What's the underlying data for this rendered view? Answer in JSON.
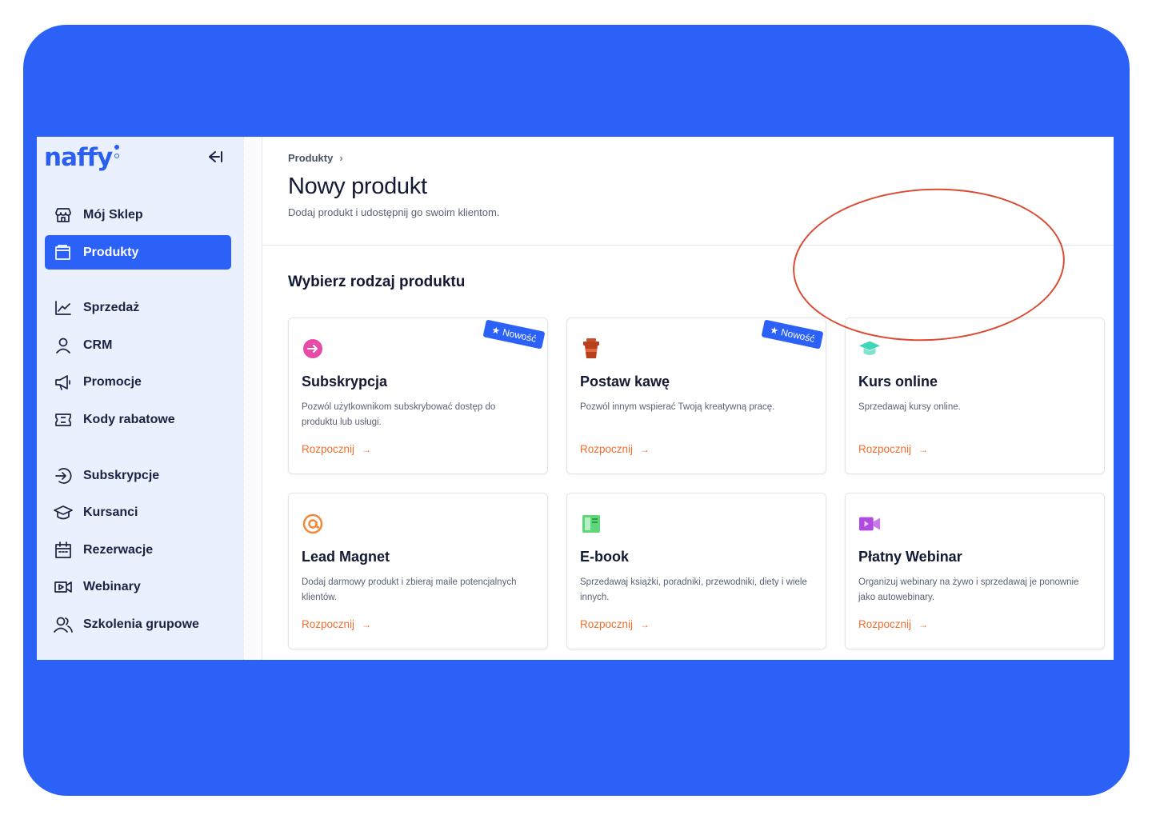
{
  "brand": {
    "logo_text": "naffy"
  },
  "sidebar": {
    "items": [
      {
        "label": "Mój Sklep",
        "icon": "store-icon"
      },
      {
        "label": "Produkty",
        "icon": "folder-icon",
        "active": true
      },
      {
        "label": "Sprzedaż",
        "icon": "chart-line-icon"
      },
      {
        "label": "CRM",
        "icon": "user-icon"
      },
      {
        "label": "Promocje",
        "icon": "megaphone-icon"
      },
      {
        "label": "Kody rabatowe",
        "icon": "ticket-icon"
      },
      {
        "label": "Subskrypcje",
        "icon": "subscription-arrow-icon"
      },
      {
        "label": "Kursanci",
        "icon": "graduation-cap-icon"
      },
      {
        "label": "Rezerwacje",
        "icon": "calendar-icon"
      },
      {
        "label": "Webinary",
        "icon": "video-icon"
      },
      {
        "label": "Szkolenia grupowe",
        "icon": "users-icon"
      }
    ]
  },
  "breadcrumb": {
    "root": "Produkty",
    "separator": "›"
  },
  "header": {
    "title": "Nowy produkt",
    "subtitle": "Dodaj produkt i udostępnij go swoim klientom."
  },
  "section_title": "Wybierz rodzaj produktu",
  "cards": [
    {
      "title": "Subskrypcja",
      "desc": "Pozwól użytkownikom subskrybować dostęp do produktu lub usługi.",
      "link": "Rozpocznij",
      "badge": "★ Nowość",
      "icon": "subscription-icon",
      "color": "#e84aa8"
    },
    {
      "title": "Postaw kawę",
      "desc": "Pozwól innym wspierać Twoją kreatywną pracę.",
      "link": "Rozpocznij",
      "badge": "★ Nowość",
      "icon": "coffee-cup-icon",
      "color": "#b8401f"
    },
    {
      "title": "Kurs online",
      "desc": "Sprzedawaj kursy online.",
      "link": "Rozpocznij",
      "icon": "graduation-cap-icon",
      "color": "#3fd7b8"
    },
    {
      "title": "Lead Magnet",
      "desc": "Dodaj darmowy produkt i zbieraj maile potencjalnych klientów.",
      "link": "Rozpocznij",
      "icon": "at-sign-icon",
      "color": "#f08a3c"
    },
    {
      "title": "E-book",
      "desc": "Sprzedawaj książki, poradniki, przewodniki, diety i wiele innych.",
      "link": "Rozpocznij",
      "icon": "book-icon",
      "color": "#5fd67a"
    },
    {
      "title": "Płatny Webinar",
      "desc": "Organizuj webinary na żywo i sprzedawaj je ponownie jako autowebinary.",
      "link": "Rozpocznij",
      "icon": "video-camera-icon",
      "color": "#b04be0"
    }
  ],
  "colors": {
    "frame": "#2b61f7",
    "accent": "#2b61f7",
    "link": "#f06d2c",
    "annotation": "#d94b33",
    "sidebar_bg": "#eaf0fd"
  }
}
